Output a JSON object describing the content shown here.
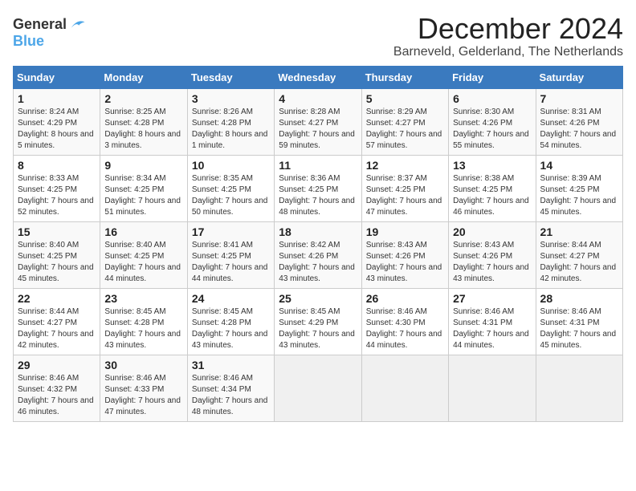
{
  "logo": {
    "line1": "General",
    "line2": "Blue"
  },
  "title": "December 2024",
  "subtitle": "Barneveld, Gelderland, The Netherlands",
  "days_of_week": [
    "Sunday",
    "Monday",
    "Tuesday",
    "Wednesday",
    "Thursday",
    "Friday",
    "Saturday"
  ],
  "weeks": [
    [
      {
        "day": 1,
        "sunrise": "8:24 AM",
        "sunset": "4:29 PM",
        "daylight": "8 hours and 5 minutes."
      },
      {
        "day": 2,
        "sunrise": "8:25 AM",
        "sunset": "4:28 PM",
        "daylight": "8 hours and 3 minutes."
      },
      {
        "day": 3,
        "sunrise": "8:26 AM",
        "sunset": "4:28 PM",
        "daylight": "8 hours and 1 minute."
      },
      {
        "day": 4,
        "sunrise": "8:28 AM",
        "sunset": "4:27 PM",
        "daylight": "7 hours and 59 minutes."
      },
      {
        "day": 5,
        "sunrise": "8:29 AM",
        "sunset": "4:27 PM",
        "daylight": "7 hours and 57 minutes."
      },
      {
        "day": 6,
        "sunrise": "8:30 AM",
        "sunset": "4:26 PM",
        "daylight": "7 hours and 55 minutes."
      },
      {
        "day": 7,
        "sunrise": "8:31 AM",
        "sunset": "4:26 PM",
        "daylight": "7 hours and 54 minutes."
      }
    ],
    [
      {
        "day": 8,
        "sunrise": "8:33 AM",
        "sunset": "4:25 PM",
        "daylight": "7 hours and 52 minutes."
      },
      {
        "day": 9,
        "sunrise": "8:34 AM",
        "sunset": "4:25 PM",
        "daylight": "7 hours and 51 minutes."
      },
      {
        "day": 10,
        "sunrise": "8:35 AM",
        "sunset": "4:25 PM",
        "daylight": "7 hours and 50 minutes."
      },
      {
        "day": 11,
        "sunrise": "8:36 AM",
        "sunset": "4:25 PM",
        "daylight": "7 hours and 48 minutes."
      },
      {
        "day": 12,
        "sunrise": "8:37 AM",
        "sunset": "4:25 PM",
        "daylight": "7 hours and 47 minutes."
      },
      {
        "day": 13,
        "sunrise": "8:38 AM",
        "sunset": "4:25 PM",
        "daylight": "7 hours and 46 minutes."
      },
      {
        "day": 14,
        "sunrise": "8:39 AM",
        "sunset": "4:25 PM",
        "daylight": "7 hours and 45 minutes."
      }
    ],
    [
      {
        "day": 15,
        "sunrise": "8:40 AM",
        "sunset": "4:25 PM",
        "daylight": "7 hours and 45 minutes."
      },
      {
        "day": 16,
        "sunrise": "8:40 AM",
        "sunset": "4:25 PM",
        "daylight": "7 hours and 44 minutes."
      },
      {
        "day": 17,
        "sunrise": "8:41 AM",
        "sunset": "4:25 PM",
        "daylight": "7 hours and 44 minutes."
      },
      {
        "day": 18,
        "sunrise": "8:42 AM",
        "sunset": "4:26 PM",
        "daylight": "7 hours and 43 minutes."
      },
      {
        "day": 19,
        "sunrise": "8:43 AM",
        "sunset": "4:26 PM",
        "daylight": "7 hours and 43 minutes."
      },
      {
        "day": 20,
        "sunrise": "8:43 AM",
        "sunset": "4:26 PM",
        "daylight": "7 hours and 43 minutes."
      },
      {
        "day": 21,
        "sunrise": "8:44 AM",
        "sunset": "4:27 PM",
        "daylight": "7 hours and 42 minutes."
      }
    ],
    [
      {
        "day": 22,
        "sunrise": "8:44 AM",
        "sunset": "4:27 PM",
        "daylight": "7 hours and 42 minutes."
      },
      {
        "day": 23,
        "sunrise": "8:45 AM",
        "sunset": "4:28 PM",
        "daylight": "7 hours and 43 minutes."
      },
      {
        "day": 24,
        "sunrise": "8:45 AM",
        "sunset": "4:28 PM",
        "daylight": "7 hours and 43 minutes."
      },
      {
        "day": 25,
        "sunrise": "8:45 AM",
        "sunset": "4:29 PM",
        "daylight": "7 hours and 43 minutes."
      },
      {
        "day": 26,
        "sunrise": "8:46 AM",
        "sunset": "4:30 PM",
        "daylight": "7 hours and 44 minutes."
      },
      {
        "day": 27,
        "sunrise": "8:46 AM",
        "sunset": "4:31 PM",
        "daylight": "7 hours and 44 minutes."
      },
      {
        "day": 28,
        "sunrise": "8:46 AM",
        "sunset": "4:31 PM",
        "daylight": "7 hours and 45 minutes."
      }
    ],
    [
      {
        "day": 29,
        "sunrise": "8:46 AM",
        "sunset": "4:32 PM",
        "daylight": "7 hours and 46 minutes."
      },
      {
        "day": 30,
        "sunrise": "8:46 AM",
        "sunset": "4:33 PM",
        "daylight": "7 hours and 47 minutes."
      },
      {
        "day": 31,
        "sunrise": "8:46 AM",
        "sunset": "4:34 PM",
        "daylight": "7 hours and 48 minutes."
      },
      null,
      null,
      null,
      null
    ]
  ]
}
